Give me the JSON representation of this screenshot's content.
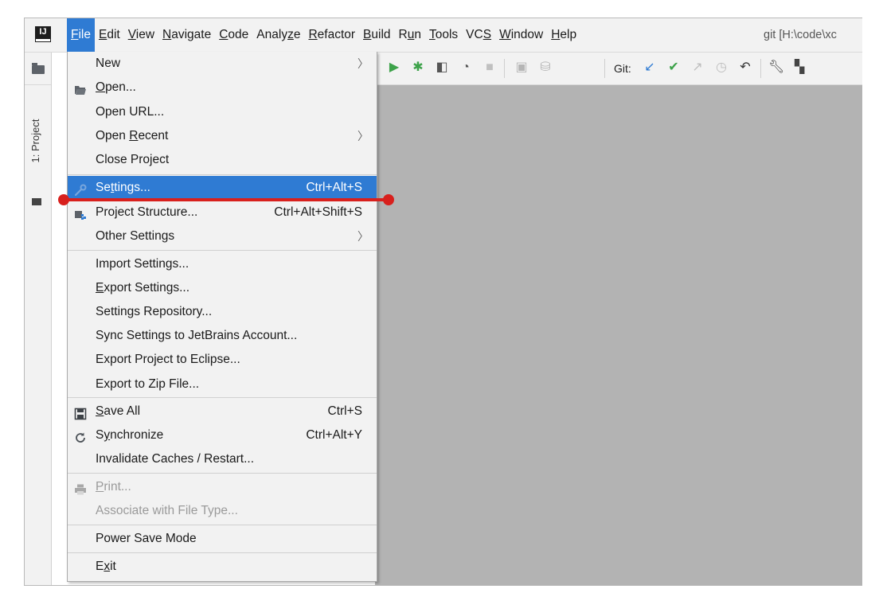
{
  "app": {
    "logo_text": "IJ",
    "window_title": "git [H:\\code\\xc"
  },
  "menubar": [
    {
      "pre": "",
      "ul": "F",
      "post": "ile",
      "active": true
    },
    {
      "pre": "",
      "ul": "E",
      "post": "dit"
    },
    {
      "pre": "",
      "ul": "V",
      "post": "iew"
    },
    {
      "pre": "",
      "ul": "N",
      "post": "avigate"
    },
    {
      "pre": "",
      "ul": "C",
      "post": "ode"
    },
    {
      "pre": "Analy",
      "ul": "z",
      "post": "e"
    },
    {
      "pre": "",
      "ul": "R",
      "post": "efactor"
    },
    {
      "pre": "",
      "ul": "B",
      "post": "uild"
    },
    {
      "pre": "R",
      "ul": "u",
      "post": "n"
    },
    {
      "pre": "",
      "ul": "T",
      "post": "ools"
    },
    {
      "pre": "VC",
      "ul": "S",
      "post": ""
    },
    {
      "pre": "",
      "ul": "W",
      "post": "indow"
    },
    {
      "pre": "",
      "ul": "H",
      "post": "elp"
    }
  ],
  "side_strip": {
    "project_tab": "1: Project"
  },
  "toolbar": {
    "git_label": "Git:"
  },
  "file_menu": {
    "new": "New",
    "open_ul": "O",
    "open_rest": "pen...",
    "open_url": "Open URL...",
    "open_recent_pre": "Open ",
    "open_recent_ul": "R",
    "open_recent_post": "ecent",
    "close_project": "Close Project",
    "settings_pre": "Se",
    "settings_ul": "t",
    "settings_post": "tings...",
    "settings_shortcut": "Ctrl+Alt+S",
    "project_structure": "Project Structure...",
    "project_structure_shortcut": "Ctrl+Alt+Shift+S",
    "other_settings": "Other Settings",
    "import_settings": "Import Settings...",
    "export_settings_ul": "E",
    "export_settings_rest": "xport Settings...",
    "settings_repository": "Settings Repository...",
    "sync_settings": "Sync Settings to JetBrains Account...",
    "export_eclipse": "Export Project to Eclipse...",
    "export_zip": "Export to Zip File...",
    "save_all_ul": "S",
    "save_all_rest": "ave All",
    "save_all_shortcut": "Ctrl+S",
    "sync_pre": "S",
    "sync_ul": "y",
    "sync_post": "nchronize",
    "sync_shortcut": "Ctrl+Alt+Y",
    "invalidate": "Invalidate Caches / Restart...",
    "print_ul": "P",
    "print_rest": "rint...",
    "associate": "Associate with File Type...",
    "power_save": "Power Save Mode",
    "exit_pre": "E",
    "exit_ul": "x",
    "exit_post": "it"
  },
  "colors": {
    "selection": "#2f7bd3",
    "annotation": "#d8201d",
    "editor_bg": "#b3b3b3"
  }
}
